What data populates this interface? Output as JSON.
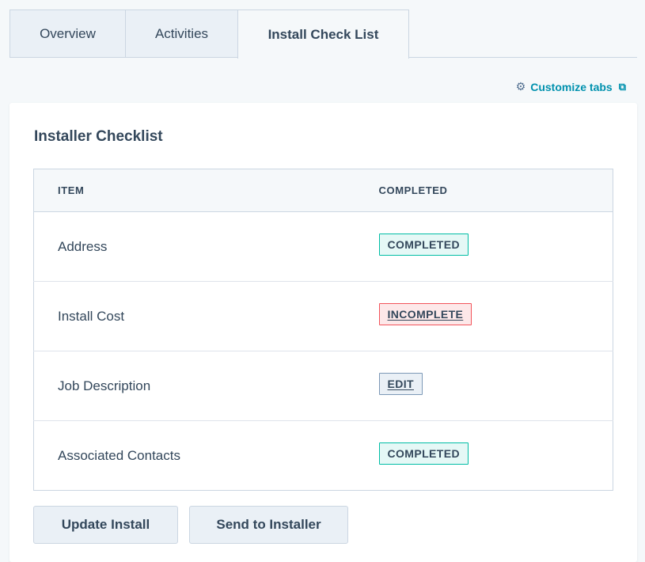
{
  "tabs": [
    {
      "label": "Overview"
    },
    {
      "label": "Activities"
    },
    {
      "label": "Install Check List"
    }
  ],
  "customize": {
    "label": "Customize tabs",
    "gear_glyph": "⚙",
    "ext_glyph": "⧉"
  },
  "card": {
    "title": "Installer Checklist"
  },
  "table": {
    "headers": {
      "item": "ITEM",
      "completed": "COMPLETED"
    },
    "rows": [
      {
        "item": "Address",
        "status": "COMPLETED"
      },
      {
        "item": "Install Cost",
        "status": "INCOMPLETE"
      },
      {
        "item": "Job Description",
        "status": "EDIT"
      },
      {
        "item": "Associated Contacts",
        "status": "COMPLETED"
      }
    ]
  },
  "buttons": {
    "update": "Update Install",
    "send": "Send to Installer"
  },
  "colors": {
    "accent": "#0091ae",
    "completed": "#00bda5",
    "incomplete": "#f2545b",
    "edit": "#7c98b6"
  }
}
